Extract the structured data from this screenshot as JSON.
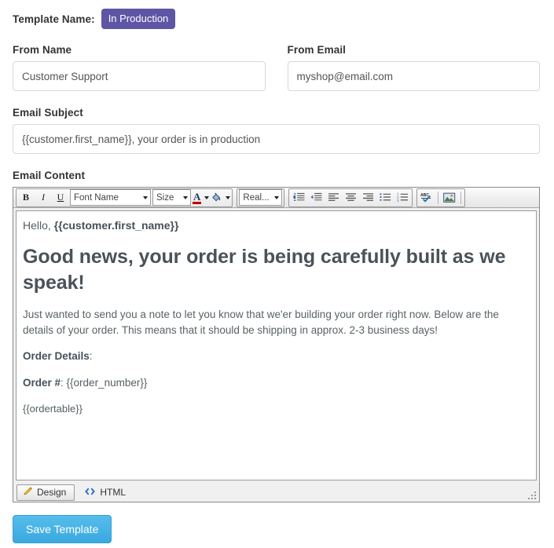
{
  "form": {
    "template_name_label": "Template Name:",
    "status_badge": "In Production",
    "status_badge_color": "#5f55a5",
    "from_name_label": "From Name",
    "from_name_value": "Customer Support",
    "from_name_placeholder": "From Name",
    "from_email_label": "From Email",
    "from_email_value": "myshop@email.com",
    "from_email_placeholder": "From Email",
    "email_subject_label": "Email Subject",
    "email_subject_value": "{{customer.first_name}}, your order is in production",
    "email_subject_placeholder": "Email Subject",
    "email_content_label": "Email Content"
  },
  "toolbar": {
    "bold": "B",
    "italic": "I",
    "underline": "U",
    "font_name": "Font Name",
    "font_size": "Size",
    "font_color_icon": "A",
    "highlight_icon": "paint-bucket-icon",
    "style_select": "Real...",
    "indent_increase": "indent-increase-icon",
    "indent_decrease": "indent-decrease-icon",
    "align_left": "align-left-icon",
    "align_center": "align-center-icon",
    "align_right": "align-right-icon",
    "bullet_list": "bullet-list-icon",
    "numbered_list": "numbered-list-icon",
    "spellcheck": "ABC",
    "insert_image": "insert-image-icon"
  },
  "content": {
    "greeting_plain": "Hello, ",
    "greeting_token": "{{customer.first_name}}",
    "heading": "Good news, your order is being carefully built as we speak!",
    "paragraph": "Just wanted to send you a note to let you know that we'er building your order right now. Below are the details of your order. This means that it should be shipping in approx. 2-3 business days!",
    "order_details_label": "Order Details",
    "order_details_colon": ":",
    "order_number_label": "Order #",
    "order_number_value": ": {{order_number}}",
    "order_table_token": "{{ordertable}}"
  },
  "tabs": {
    "design": "Design",
    "html": "HTML",
    "active": "Design"
  },
  "actions": {
    "save_label": "Save Template",
    "save_color": "#3aa9e0"
  }
}
